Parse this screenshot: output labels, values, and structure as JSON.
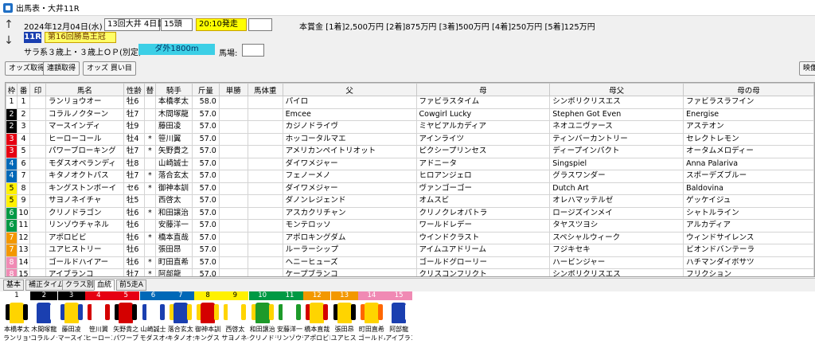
{
  "window": {
    "title": "出馬表・大井11R"
  },
  "header": {
    "date_text": "2024年12月04日(水)",
    "meeting": "13回大井 4日目",
    "runners": "15頭",
    "post_time": "20:10発走",
    "race_no": "11R",
    "race_name": "第16回勝島王冠",
    "conditions": "サラ系３歳上・３歳上ＯＰ(別定)",
    "course": "ダ外1800m",
    "baba_label": "馬場:",
    "prize": "本賞金 [1着]2,500万円 [2着]875万円 [3着]500万円 [4着]250万円 [5着]125万円",
    "nav_up": "↑",
    "nav_down": "↓"
  },
  "toolbar": {
    "odds_get": "オッズ取得",
    "renpo_get": "連額取得",
    "odds_buy": "オッズ 買い目",
    "right_btn": "映像"
  },
  "table": {
    "columns": [
      "枠",
      "番",
      "印",
      "馬名",
      "性齢",
      "替",
      "騎手",
      "斤量",
      "単勝",
      "馬体重",
      "父",
      "母",
      "母父",
      "母の母"
    ],
    "rows": [
      {
        "waku": "1",
        "num": "1",
        "name": "ランリョウオー",
        "sex": "牡6",
        "kae": "",
        "jockey": "本橋孝太",
        "kin": "58.0",
        "sire": "パイロ",
        "dam": "ファビラスタイム",
        "bms": "シンボリクリスエス",
        "mm": "ファビラスラフイン"
      },
      {
        "waku": "2",
        "num": "2",
        "name": "コラルノクターン",
        "sex": "牡7",
        "kae": "",
        "jockey": "木間塚龍",
        "kin": "57.0",
        "sire": "Emcee",
        "dam": "Cowgirl Lucky",
        "bms": "Stephen Got Even",
        "mm": "Energise"
      },
      {
        "waku": "2",
        "num": "3",
        "name": "マースインディ",
        "sex": "牡9",
        "kae": "",
        "jockey": "藤田凌",
        "kin": "57.0",
        "sire": "カジノドライヴ",
        "dam": "ミヤビアルカディア",
        "bms": "ネオユニヴァース",
        "mm": "アステオン"
      },
      {
        "waku": "3",
        "num": "4",
        "name": "ヒーローコール",
        "sex": "牡4",
        "kae": "*",
        "jockey": "笹川翼",
        "kin": "57.0",
        "sire": "ホッコータルマエ",
        "dam": "アインライツ",
        "bms": "ティンバーカントリー",
        "mm": "セレクトレモン"
      },
      {
        "waku": "3",
        "num": "5",
        "name": "パワーブローキング",
        "sex": "牡7",
        "kae": "*",
        "jockey": "矢野貴之",
        "kin": "57.0",
        "sire": "アメリカンペイトリオット",
        "dam": "ピクシープリンセス",
        "bms": "ディープインパクト",
        "mm": "オータムメロディー"
      },
      {
        "waku": "4",
        "num": "6",
        "name": "モダスオペランディ",
        "sex": "牡8",
        "kae": "",
        "jockey": "山崎誠士",
        "kin": "57.0",
        "sire": "ダイワメジャー",
        "dam": "アドニータ",
        "bms": "Singspiel",
        "mm": "Anna Palariva"
      },
      {
        "waku": "4",
        "num": "7",
        "name": "キタノオクトパス",
        "sex": "牡7",
        "kae": "*",
        "jockey": "落合玄太",
        "kin": "57.0",
        "sire": "フェノーメノ",
        "dam": "ヒロアンジェロ",
        "bms": "グラスワンダー",
        "mm": "スポーデズブルー"
      },
      {
        "waku": "5",
        "num": "8",
        "name": "キングストンボーイ",
        "sex": "セ6",
        "kae": "*",
        "jockey": "御神本訓",
        "kin": "57.0",
        "sire": "ダイワメジャー",
        "dam": "ヴァンゴーゴー",
        "bms": "Dutch Art",
        "mm": "Baldovina"
      },
      {
        "waku": "5",
        "num": "9",
        "name": "サヨノネイチャ",
        "sex": "牡5",
        "kae": "",
        "jockey": "西啓太",
        "kin": "57.0",
        "sire": "ダノンレジェンド",
        "dam": "オムスビ",
        "bms": "オレハマッテルゼ",
        "mm": "ゲッケイジュ"
      },
      {
        "waku": "6",
        "num": "10",
        "name": "クリノドラゴン",
        "sex": "牡6",
        "kae": "*",
        "jockey": "和田譲治",
        "kin": "57.0",
        "sire": "アスカクリチャン",
        "dam": "クリノクレオパトラ",
        "bms": "ロージズインメイ",
        "mm": "シャトルライン"
      },
      {
        "waku": "6",
        "num": "11",
        "name": "リンゾウチャネル",
        "sex": "牡6",
        "kae": "",
        "jockey": "安藤洋一",
        "kin": "57.0",
        "sire": "モンテロッソ",
        "dam": "ワールドレデー",
        "bms": "タヤスツヨシ",
        "mm": "アルカディア"
      },
      {
        "waku": "7",
        "num": "12",
        "name": "アポロビビ",
        "sex": "牡6",
        "kae": "*",
        "jockey": "橋本直哉",
        "kin": "57.0",
        "sire": "アポロキングダム",
        "dam": "ウインドクラスト",
        "bms": "スペシャルウィーク",
        "mm": "ウィンドサイレンス"
      },
      {
        "waku": "7",
        "num": "13",
        "name": "ユアヒストリー",
        "sex": "牡6",
        "kae": "",
        "jockey": "張田昂",
        "kin": "57.0",
        "sire": "ルーラーシップ",
        "dam": "アイムユアドリーム",
        "bms": "フジキセキ",
        "mm": "ビオンドバンテーラ"
      },
      {
        "waku": "8",
        "num": "14",
        "name": "ゴールドハイアー",
        "sex": "牡6",
        "kae": "*",
        "jockey": "町田直希",
        "kin": "57.0",
        "sire": "ヘニーヒューズ",
        "dam": "ゴールドグローリー",
        "bms": "ハービンジャー",
        "mm": "ハチマンダイボサツ"
      },
      {
        "waku": "8",
        "num": "15",
        "name": "アイブランコ",
        "sex": "牡7",
        "kae": "*",
        "jockey": "阿部龍",
        "kin": "57.0",
        "sire": "ケープブランコ",
        "dam": "クリスコンフリクト",
        "bms": "シンボリクリスエス",
        "mm": "フリクション"
      }
    ]
  },
  "tabs": [
    "基本",
    "補正タイム",
    "クラス別者",
    "血統",
    "前5走A"
  ],
  "silks": [
    {
      "num": "1",
      "jockey": "本橋孝太",
      "horse": "ランリョウ",
      "body": "#ffd400",
      "sleeve": "#000000"
    },
    {
      "num": "2",
      "jockey": "木間塚龍",
      "horse": "コラルノク",
      "body": "#1a3fb0",
      "sleeve": "#ffffff"
    },
    {
      "num": "3",
      "jockey": "藤田凌",
      "horse": "マースイン",
      "body": "#ffd400",
      "sleeve": "#1a3fb0"
    },
    {
      "num": "4",
      "jockey": "笹川翼",
      "horse": "ヒーローコ",
      "body": "#ffffff",
      "sleeve": "#d40000"
    },
    {
      "num": "5",
      "jockey": "矢野貴之",
      "horse": "パワーブ",
      "body": "#d40000",
      "sleeve": "#000000"
    },
    {
      "num": "6",
      "jockey": "山崎誠士",
      "horse": "モダスオペ",
      "body": "#ffffff",
      "sleeve": "#1a3fb0"
    },
    {
      "num": "7",
      "jockey": "落合玄太",
      "horse": "キタノオク",
      "body": "#1a3fb0",
      "sleeve": "#ffd400"
    },
    {
      "num": "8",
      "jockey": "御神本訓",
      "horse": "キングスト",
      "body": "#d40000",
      "sleeve": "#ffd400"
    },
    {
      "num": "9",
      "jockey": "西啓太",
      "horse": "サヨノネイ",
      "body": "#ffffff",
      "sleeve": "#ffd400"
    },
    {
      "num": "10",
      "jockey": "和田譲治",
      "horse": "クリノドラ",
      "body": "#1d9a2a",
      "sleeve": "#ffd400"
    },
    {
      "num": "11",
      "jockey": "安藤洋一",
      "horse": "リンゾウチ",
      "body": "#ffffff",
      "sleeve": "#1d9a2a"
    },
    {
      "num": "12",
      "jockey": "橋本直哉",
      "horse": "アポロビビ",
      "body": "#ffd400",
      "sleeve": "#d40000"
    },
    {
      "num": "13",
      "jockey": "張田昂",
      "horse": "ユアヒスト",
      "body": "#ffd400",
      "sleeve": "#000000"
    },
    {
      "num": "14",
      "jockey": "町田直希",
      "horse": "ゴールドハ",
      "body": "#ffd400",
      "sleeve": "#ff6600"
    },
    {
      "num": "15",
      "jockey": "阿部龍",
      "horse": "アイブラン",
      "body": "#1a3fb0",
      "sleeve": "#ffffff"
    }
  ],
  "colors": {
    "waku": {
      "1": "#ffffff",
      "2": "#000000",
      "3": "#e60012",
      "4": "#0068b7",
      "5": "#fff100",
      "6": "#009944",
      "7": "#f39800",
      "8": "#f08ab4"
    },
    "waku_text": {
      "1": "#000000",
      "2": "#ffffff",
      "3": "#ffffff",
      "4": "#ffffff",
      "5": "#000000",
      "6": "#ffffff",
      "7": "#ffffff",
      "8": "#ffffff"
    }
  }
}
